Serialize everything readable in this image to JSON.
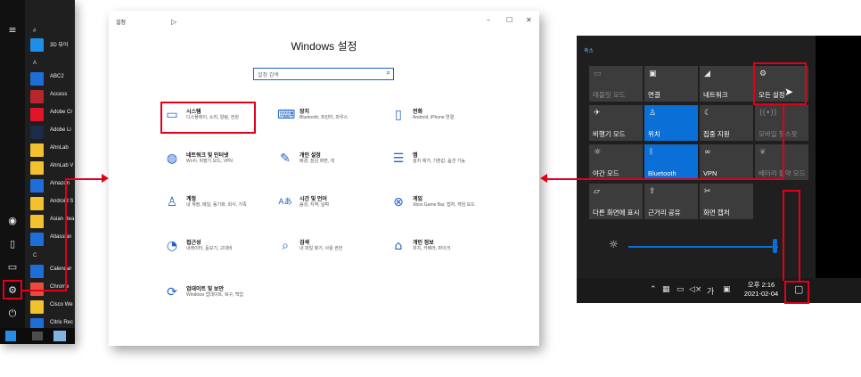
{
  "start_menu": {
    "letters": [
      "#",
      "A",
      "C"
    ],
    "apps": [
      {
        "name": "3D 뷰어",
        "color": "#1e8fe8"
      },
      {
        "name": "ABC2",
        "color": "#1e6ed8"
      },
      {
        "name": "Access",
        "color": "#b6262b"
      },
      {
        "name": "Adobe Cr",
        "color": "#e0152a"
      },
      {
        "name": "Adobe Li",
        "color": "#1b2b4a"
      },
      {
        "name": "AhnLab",
        "color": "#f2c12e"
      },
      {
        "name": "AhnLab V",
        "color": "#f2c12e"
      },
      {
        "name": "Amazon",
        "color": "#1e6ed8"
      },
      {
        "name": "Android S",
        "color": "#f2c12e"
      },
      {
        "name": "Asian Bea",
        "color": "#f2c12e"
      },
      {
        "name": "Atlassian",
        "color": "#1e6ed8"
      },
      {
        "name": "Calendar",
        "color": "#1e6ed8"
      },
      {
        "name": "Chrome",
        "color": "#e94b3c"
      },
      {
        "name": "Cisco We",
        "color": "#f2c12e"
      },
      {
        "name": "Citrix Rec",
        "color": "#1e6ed8"
      }
    ],
    "rail_icons": [
      "hamburger-icon",
      "user-icon",
      "document-icon",
      "picture-icon",
      "gear-icon",
      "power-icon",
      "windows-icon"
    ]
  },
  "settings_window": {
    "title": "설정",
    "minimize": "–",
    "maximize": "☐",
    "close": "✕",
    "heading": "Windows 설정",
    "search_placeholder": "설정 검색",
    "categories": [
      {
        "title": "시스템",
        "desc": "디스플레이, 소리, 알림, 전원",
        "icon": "laptop-icon"
      },
      {
        "title": "장치",
        "desc": "Bluetooth, 프린터, 마우스",
        "icon": "keyboard-icon"
      },
      {
        "title": "전화",
        "desc": "Android, iPhone 연결",
        "icon": "phone-icon"
      },
      {
        "title": "네트워크 및 인터넷",
        "desc": "Wi-Fi, 비행기 모드, VPN",
        "icon": "globe-icon"
      },
      {
        "title": "개인 설정",
        "desc": "배경, 잠금 화면, 색",
        "icon": "paint-icon"
      },
      {
        "title": "앱",
        "desc": "설치 제거, 기본값, 옵션 기능",
        "icon": "apps-list-icon"
      },
      {
        "title": "계정",
        "desc": "내 계정, 메일, 동기화, 회사, 가족",
        "icon": "person-icon"
      },
      {
        "title": "시간 및 언어",
        "desc": "음성, 지역, 날짜",
        "icon": "time-language-icon"
      },
      {
        "title": "게임",
        "desc": "Xbox Game Bar, 캡처, 게임 모드",
        "icon": "xbox-icon"
      },
      {
        "title": "접근성",
        "desc": "내레이터, 돋보기, 고대비",
        "icon": "accessibility-icon"
      },
      {
        "title": "검색",
        "desc": "내 파일 찾기, 사용 권한",
        "icon": "search-icon"
      },
      {
        "title": "개인 정보",
        "desc": "위치, 카메라, 마이크",
        "icon": "lock-icon"
      },
      {
        "title": "업데이트 및 보안",
        "desc": "Windows 업데이트, 복구, 백업",
        "icon": "sync-icon"
      }
    ]
  },
  "action_center": {
    "collapse": "축소",
    "tiles": [
      {
        "label": "태블릿 모드",
        "icon": "tablet-icon",
        "state": "dim"
      },
      {
        "label": "연결",
        "icon": "connect-icon",
        "state": "off"
      },
      {
        "label": "네트워크",
        "icon": "network-icon",
        "state": "off"
      },
      {
        "label": "모든 설정",
        "icon": "gear-icon",
        "state": "off"
      },
      {
        "label": "비행기 모드",
        "icon": "airplane-icon",
        "state": "off"
      },
      {
        "label": "위치",
        "icon": "location-icon",
        "state": "on"
      },
      {
        "label": "집중 지원",
        "icon": "moon-icon",
        "state": "off"
      },
      {
        "label": "모바일 핫스팟",
        "icon": "hotspot-icon",
        "state": "dim"
      },
      {
        "label": "야간 모드",
        "icon": "sun-icon",
        "state": "off"
      },
      {
        "label": "Bluetooth",
        "icon": "bluetooth-icon",
        "state": "on"
      },
      {
        "label": "VPN",
        "icon": "vpn-icon",
        "state": "off"
      },
      {
        "label": "배터리 절약 모드",
        "icon": "battery-leaf-icon",
        "state": "dim"
      },
      {
        "label": "다른 화면에 표시",
        "icon": "project-icon",
        "state": "off"
      },
      {
        "label": "근거리 공유",
        "icon": "share-icon",
        "state": "off"
      },
      {
        "label": "화면 캡처",
        "icon": "snip-icon",
        "state": "off"
      }
    ],
    "brightness": 0.98,
    "tray_ime": "가",
    "clock_time": "오후 2:16",
    "clock_date": "2021-02-04"
  },
  "colors": {
    "accent": "#0a6fd6",
    "highlight": "#e0001a"
  }
}
